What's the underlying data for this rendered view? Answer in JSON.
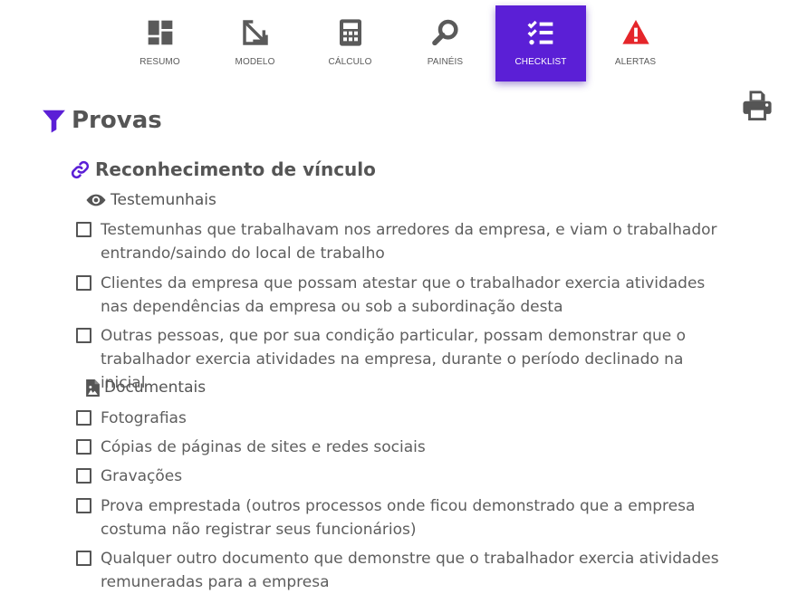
{
  "nav": [
    {
      "label": "RESUMO",
      "icon": "dashboard-icon"
    },
    {
      "label": "MODELO",
      "icon": "resize-arrow-icon"
    },
    {
      "label": "CÁLCULO",
      "icon": "calculator-icon"
    },
    {
      "label": "PAINÉIS",
      "icon": "search-icon"
    },
    {
      "label": "CHECKLIST",
      "icon": "checklist-icon",
      "active": true
    },
    {
      "label": "ALERTAS",
      "icon": "warning-icon"
    }
  ],
  "colors": {
    "accent": "#5b1fd6",
    "alert": "#e5252a",
    "text": "#555555"
  },
  "section": {
    "title": "Provas"
  },
  "subsection": {
    "title": "Reconhecimento de vínculo"
  },
  "groups": {
    "testemunhais": {
      "heading": "Testemunhais",
      "items": [
        "Testemunhas que trabalhavam nos arredores da empresa, e viam o trabalhador entrando/saindo do local de trabalho",
        "Clientes da empresa que possam atestar que o trabalhador exercia atividades nas dependências da empresa ou sob a subordinação desta",
        "Outras pessoas, que por sua condição particular, possam demonstrar que o trabalhador exercia atividades na empresa, durante o período declinado na inicial"
      ]
    },
    "documentais": {
      "heading": "Documentais",
      "items": [
        "Fotografias",
        "Cópias de páginas de sites e redes sociais",
        "Gravações",
        "Prova emprestada (outros processos onde ficou demonstrado que a empresa costuma não registrar seus funcionários)",
        "Qualquer outro documento que demonstre que o trabalhador exercia atividades remuneradas para a empresa"
      ]
    }
  }
}
